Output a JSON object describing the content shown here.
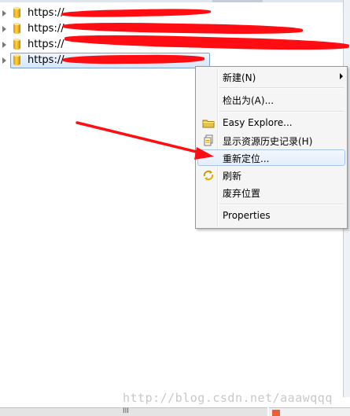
{
  "tree": {
    "items": [
      {
        "label": "https://",
        "selected": false
      },
      {
        "label": "https://",
        "selected": false
      },
      {
        "label": "https://",
        "selected": false
      },
      {
        "label": "https://",
        "selected": true
      }
    ]
  },
  "context_menu": {
    "items": [
      {
        "label": "新建(N)",
        "icon": "none",
        "has_submenu": true
      },
      {
        "label": "检出为(A)...",
        "icon": "none"
      },
      {
        "label": "Easy Explore...",
        "icon": "folder-icon"
      },
      {
        "label": "显示资源历史记录(H)",
        "icon": "history-icon"
      },
      {
        "label": "重新定位...",
        "icon": "none",
        "highlighted": true
      },
      {
        "label": "刷新",
        "icon": "refresh-icon"
      },
      {
        "label": "废弃位置",
        "icon": "none"
      },
      {
        "label": "Properties",
        "icon": "none"
      }
    ]
  },
  "watermark": "http://blog.csdn.net/aaawqqq",
  "bottom": {
    "grip": "III"
  },
  "colors": {
    "selection_border": "#7da2ce",
    "menu_highlight_border": "#aac5ec",
    "annotation_red": "#ff0d12"
  }
}
